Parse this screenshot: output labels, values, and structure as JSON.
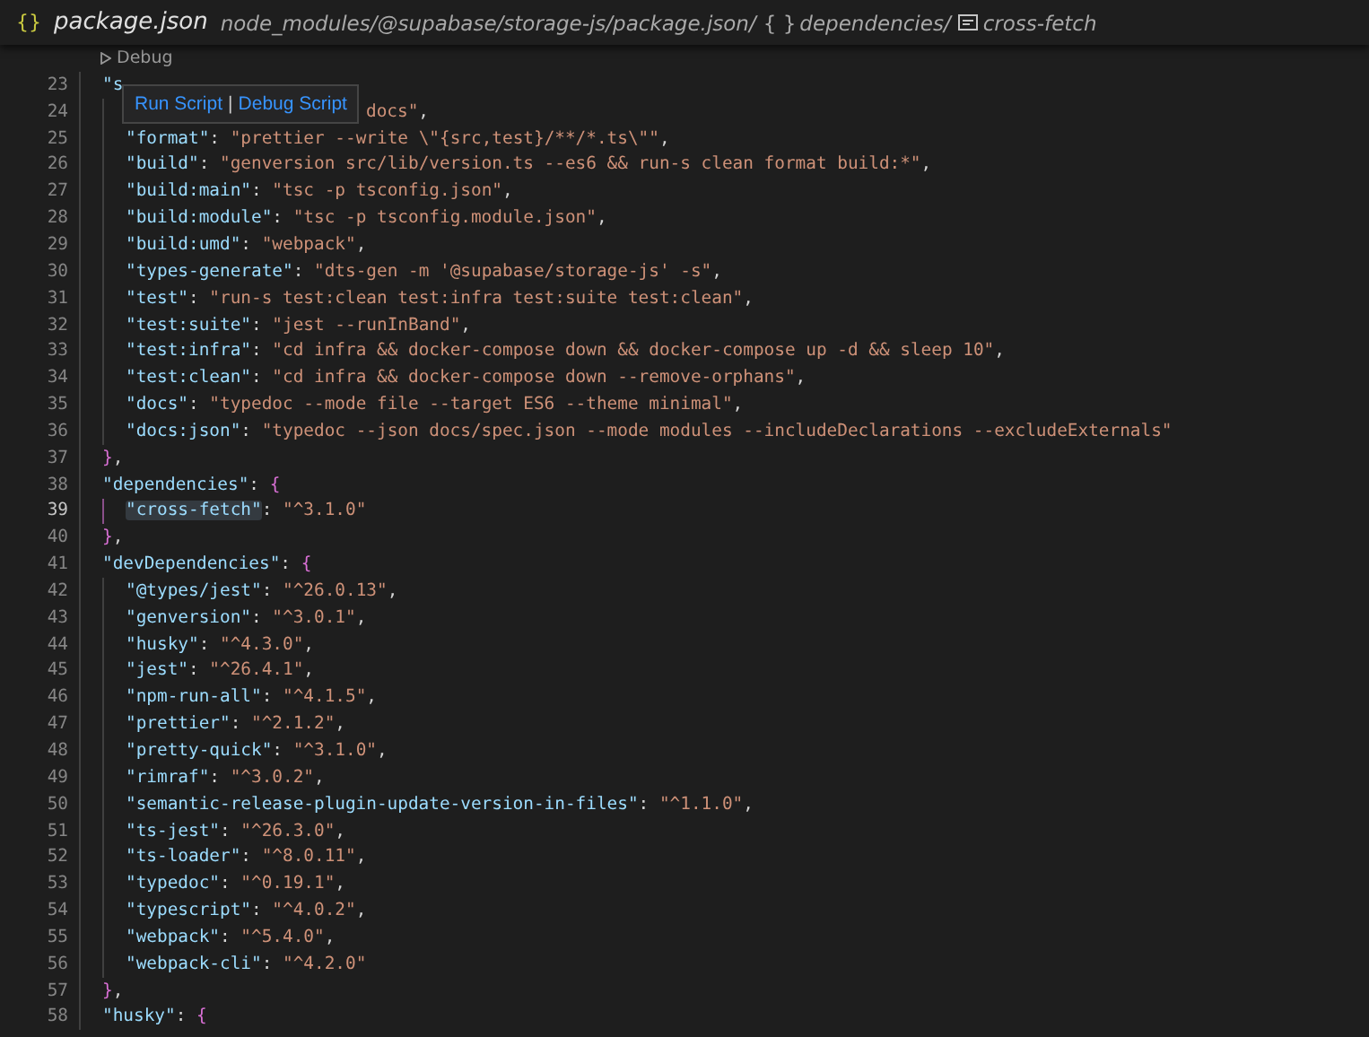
{
  "breadcrumb": [
    {
      "kind": "file",
      "icon": "{}",
      "label": "package.json"
    },
    {
      "kind": "path",
      "label": "node_modules/@supabase/storage-js/package.json/"
    },
    {
      "kind": "object",
      "icon": "{ }",
      "label": "dependencies/"
    },
    {
      "kind": "field",
      "label": "cross-fetch"
    }
  ],
  "codelens": {
    "label": "Debug"
  },
  "hover": {
    "links": [
      "Run Script",
      "Debug Script"
    ],
    "separator": "|"
  },
  "lines": [
    {
      "number": "23",
      "current": false,
      "tokens": [
        {
          "kind": "key",
          "text": "\"s"
        }
      ],
      "children": [
        {
          "number": "24",
          "current": false,
          "covered": true,
          "tokens": [
            {
              "kind": "string",
              "text": "docs\""
            },
            {
              "kind": "punct",
              "text": ","
            }
          ]
        },
        {
          "number": "25",
          "current": false,
          "tokens": [
            {
              "kind": "key",
              "text": "\"format\""
            },
            {
              "kind": "punct",
              "text": ": "
            },
            {
              "kind": "string",
              "text": "\"prettier --write \\\"{src,test}/**/*.ts\\\"\""
            },
            {
              "kind": "punct",
              "text": ","
            }
          ]
        },
        {
          "number": "26",
          "current": false,
          "tokens": [
            {
              "kind": "key",
              "text": "\"build\""
            },
            {
              "kind": "punct",
              "text": ": "
            },
            {
              "kind": "string",
              "text": "\"genversion src/lib/version.ts --es6 && run-s clean format build:*\""
            },
            {
              "kind": "punct",
              "text": ","
            }
          ]
        },
        {
          "number": "27",
          "current": false,
          "tokens": [
            {
              "kind": "key",
              "text": "\"build:main\""
            },
            {
              "kind": "punct",
              "text": ": "
            },
            {
              "kind": "string",
              "text": "\"tsc -p tsconfig.json\""
            },
            {
              "kind": "punct",
              "text": ","
            }
          ]
        },
        {
          "number": "28",
          "current": false,
          "tokens": [
            {
              "kind": "key",
              "text": "\"build:module\""
            },
            {
              "kind": "punct",
              "text": ": "
            },
            {
              "kind": "string",
              "text": "\"tsc -p tsconfig.module.json\""
            },
            {
              "kind": "punct",
              "text": ","
            }
          ]
        },
        {
          "number": "29",
          "current": false,
          "tokens": [
            {
              "kind": "key",
              "text": "\"build:umd\""
            },
            {
              "kind": "punct",
              "text": ": "
            },
            {
              "kind": "string",
              "text": "\"webpack\""
            },
            {
              "kind": "punct",
              "text": ","
            }
          ]
        },
        {
          "number": "30",
          "current": false,
          "tokens": [
            {
              "kind": "key",
              "text": "\"types-generate\""
            },
            {
              "kind": "punct",
              "text": ": "
            },
            {
              "kind": "string",
              "text": "\"dts-gen -m '@supabase/storage-js' -s\""
            },
            {
              "kind": "punct",
              "text": ","
            }
          ]
        },
        {
          "number": "31",
          "current": false,
          "tokens": [
            {
              "kind": "key",
              "text": "\"test\""
            },
            {
              "kind": "punct",
              "text": ": "
            },
            {
              "kind": "string",
              "text": "\"run-s test:clean test:infra test:suite test:clean\""
            },
            {
              "kind": "punct",
              "text": ","
            }
          ]
        },
        {
          "number": "32",
          "current": false,
          "tokens": [
            {
              "kind": "key",
              "text": "\"test:suite\""
            },
            {
              "kind": "punct",
              "text": ": "
            },
            {
              "kind": "string",
              "text": "\"jest --runInBand\""
            },
            {
              "kind": "punct",
              "text": ","
            }
          ]
        },
        {
          "number": "33",
          "current": false,
          "tokens": [
            {
              "kind": "key",
              "text": "\"test:infra\""
            },
            {
              "kind": "punct",
              "text": ": "
            },
            {
              "kind": "string",
              "text": "\"cd infra && docker-compose down && docker-compose up -d && sleep 10\""
            },
            {
              "kind": "punct",
              "text": ","
            }
          ]
        },
        {
          "number": "34",
          "current": false,
          "tokens": [
            {
              "kind": "key",
              "text": "\"test:clean\""
            },
            {
              "kind": "punct",
              "text": ": "
            },
            {
              "kind": "string",
              "text": "\"cd infra && docker-compose down --remove-orphans\""
            },
            {
              "kind": "punct",
              "text": ","
            }
          ]
        },
        {
          "number": "35",
          "current": false,
          "tokens": [
            {
              "kind": "key",
              "text": "\"docs\""
            },
            {
              "kind": "punct",
              "text": ": "
            },
            {
              "kind": "string",
              "text": "\"typedoc --mode file --target ES6 --theme minimal\""
            },
            {
              "kind": "punct",
              "text": ","
            }
          ]
        },
        {
          "number": "36",
          "current": false,
          "tokens": [
            {
              "kind": "key",
              "text": "\"docs:json\""
            },
            {
              "kind": "punct",
              "text": ": "
            },
            {
              "kind": "string",
              "text": "\"typedoc --json docs/spec.json --mode modules --includeDeclarations --excludeExternals\""
            }
          ]
        }
      ]
    },
    {
      "number": "37",
      "current": false,
      "tokens": [
        {
          "kind": "brace",
          "text": "}"
        },
        {
          "kind": "punct",
          "text": ","
        }
      ]
    },
    {
      "number": "38",
      "current": false,
      "tokens": [
        {
          "kind": "key",
          "text": "\"dependencies\""
        },
        {
          "kind": "punct",
          "text": ": "
        },
        {
          "kind": "brace",
          "text": "{"
        }
      ],
      "children": [
        {
          "number": "39",
          "current": true,
          "tokens": [
            {
              "kind": "key",
              "text": "\"cross-fetch\""
            },
            {
              "kind": "punct",
              "text": ": "
            },
            {
              "kind": "string",
              "text": "\"^3.1.0\""
            }
          ]
        }
      ]
    },
    {
      "number": "40",
      "current": false,
      "tokens": [
        {
          "kind": "brace",
          "text": "}"
        },
        {
          "kind": "punct",
          "text": ","
        }
      ]
    },
    {
      "number": "41",
      "current": false,
      "tokens": [
        {
          "kind": "key",
          "text": "\"devDependencies\""
        },
        {
          "kind": "punct",
          "text": ": "
        },
        {
          "kind": "brace",
          "text": "{"
        }
      ],
      "children": [
        {
          "number": "42",
          "current": false,
          "tokens": [
            {
              "kind": "key",
              "text": "\"@types/jest\""
            },
            {
              "kind": "punct",
              "text": ": "
            },
            {
              "kind": "string",
              "text": "\"^26.0.13\""
            },
            {
              "kind": "punct",
              "text": ","
            }
          ]
        },
        {
          "number": "43",
          "current": false,
          "tokens": [
            {
              "kind": "key",
              "text": "\"genversion\""
            },
            {
              "kind": "punct",
              "text": ": "
            },
            {
              "kind": "string",
              "text": "\"^3.0.1\""
            },
            {
              "kind": "punct",
              "text": ","
            }
          ]
        },
        {
          "number": "44",
          "current": false,
          "tokens": [
            {
              "kind": "key",
              "text": "\"husky\""
            },
            {
              "kind": "punct",
              "text": ": "
            },
            {
              "kind": "string",
              "text": "\"^4.3.0\""
            },
            {
              "kind": "punct",
              "text": ","
            }
          ]
        },
        {
          "number": "45",
          "current": false,
          "tokens": [
            {
              "kind": "key",
              "text": "\"jest\""
            },
            {
              "kind": "punct",
              "text": ": "
            },
            {
              "kind": "string",
              "text": "\"^26.4.1\""
            },
            {
              "kind": "punct",
              "text": ","
            }
          ]
        },
        {
          "number": "46",
          "current": false,
          "tokens": [
            {
              "kind": "key",
              "text": "\"npm-run-all\""
            },
            {
              "kind": "punct",
              "text": ": "
            },
            {
              "kind": "string",
              "text": "\"^4.1.5\""
            },
            {
              "kind": "punct",
              "text": ","
            }
          ]
        },
        {
          "number": "47",
          "current": false,
          "tokens": [
            {
              "kind": "key",
              "text": "\"prettier\""
            },
            {
              "kind": "punct",
              "text": ": "
            },
            {
              "kind": "string",
              "text": "\"^2.1.2\""
            },
            {
              "kind": "punct",
              "text": ","
            }
          ]
        },
        {
          "number": "48",
          "current": false,
          "tokens": [
            {
              "kind": "key",
              "text": "\"pretty-quick\""
            },
            {
              "kind": "punct",
              "text": ": "
            },
            {
              "kind": "string",
              "text": "\"^3.1.0\""
            },
            {
              "kind": "punct",
              "text": ","
            }
          ]
        },
        {
          "number": "49",
          "current": false,
          "tokens": [
            {
              "kind": "key",
              "text": "\"rimraf\""
            },
            {
              "kind": "punct",
              "text": ": "
            },
            {
              "kind": "string",
              "text": "\"^3.0.2\""
            },
            {
              "kind": "punct",
              "text": ","
            }
          ]
        },
        {
          "number": "50",
          "current": false,
          "tokens": [
            {
              "kind": "key",
              "text": "\"semantic-release-plugin-update-version-in-files\""
            },
            {
              "kind": "punct",
              "text": ": "
            },
            {
              "kind": "string",
              "text": "\"^1.1.0\""
            },
            {
              "kind": "punct",
              "text": ","
            }
          ]
        },
        {
          "number": "51",
          "current": false,
          "tokens": [
            {
              "kind": "key",
              "text": "\"ts-jest\""
            },
            {
              "kind": "punct",
              "text": ": "
            },
            {
              "kind": "string",
              "text": "\"^26.3.0\""
            },
            {
              "kind": "punct",
              "text": ","
            }
          ]
        },
        {
          "number": "52",
          "current": false,
          "tokens": [
            {
              "kind": "key",
              "text": "\"ts-loader\""
            },
            {
              "kind": "punct",
              "text": ": "
            },
            {
              "kind": "string",
              "text": "\"^8.0.11\""
            },
            {
              "kind": "punct",
              "text": ","
            }
          ]
        },
        {
          "number": "53",
          "current": false,
          "tokens": [
            {
              "kind": "key",
              "text": "\"typedoc\""
            },
            {
              "kind": "punct",
              "text": ": "
            },
            {
              "kind": "string",
              "text": "\"^0.19.1\""
            },
            {
              "kind": "punct",
              "text": ","
            }
          ]
        },
        {
          "number": "54",
          "current": false,
          "tokens": [
            {
              "kind": "key",
              "text": "\"typescript\""
            },
            {
              "kind": "punct",
              "text": ": "
            },
            {
              "kind": "string",
              "text": "\"^4.0.2\""
            },
            {
              "kind": "punct",
              "text": ","
            }
          ]
        },
        {
          "number": "55",
          "current": false,
          "tokens": [
            {
              "kind": "key",
              "text": "\"webpack\""
            },
            {
              "kind": "punct",
              "text": ": "
            },
            {
              "kind": "string",
              "text": "\"^5.4.0\""
            },
            {
              "kind": "punct",
              "text": ","
            }
          ]
        },
        {
          "number": "56",
          "current": false,
          "tokens": [
            {
              "kind": "key",
              "text": "\"webpack-cli\""
            },
            {
              "kind": "punct",
              "text": ": "
            },
            {
              "kind": "string",
              "text": "\"^4.2.0\""
            }
          ]
        }
      ]
    },
    {
      "number": "57",
      "current": false,
      "tokens": [
        {
          "kind": "brace",
          "text": "}"
        },
        {
          "kind": "punct",
          "text": ","
        }
      ]
    },
    {
      "number": "58",
      "current": false,
      "tokens": [
        {
          "kind": "key",
          "text": "\"husky\""
        },
        {
          "kind": "punct",
          "text": ": "
        },
        {
          "kind": "brace",
          "text": "{"
        }
      ]
    }
  ]
}
